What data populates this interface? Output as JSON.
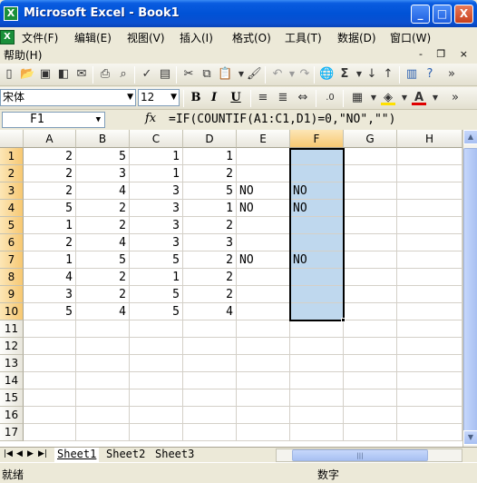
{
  "window": {
    "title": "Microsoft Excel - Book1",
    "minimize": "_",
    "maximize": "□",
    "close": "X"
  },
  "menu": {
    "items": [
      "文件(F)",
      "编辑(E)",
      "视图(V)",
      "插入(I)",
      "格式(O)",
      "工具(T)",
      "数据(D)",
      "窗口(W)",
      "帮助(H)"
    ],
    "mdi": "- ❐ ×"
  },
  "format": {
    "font_name": "宋体",
    "font_size": "12",
    "bold": "B",
    "italic": "I",
    "underline": "U"
  },
  "formula_bar": {
    "name_box": "F1",
    "fx": "fx",
    "formula": "=IF(COUNTIF(A1:C1,D1)=0,\"NO\",\"\")"
  },
  "grid": {
    "columns": [
      "A",
      "B",
      "C",
      "D",
      "E",
      "F",
      "G",
      "H"
    ],
    "rows": [
      "1",
      "2",
      "3",
      "4",
      "5",
      "6",
      "7",
      "8",
      "9",
      "10",
      "11",
      "12",
      "13",
      "14",
      "15",
      "16",
      "17"
    ],
    "data": [
      [
        "2",
        "5",
        "1",
        "1",
        "",
        ""
      ],
      [
        "2",
        "3",
        "1",
        "2",
        "",
        ""
      ],
      [
        "2",
        "4",
        "3",
        "5",
        "NO",
        "NO"
      ],
      [
        "5",
        "2",
        "3",
        "1",
        "NO",
        "NO"
      ],
      [
        "1",
        "2",
        "3",
        "2",
        "",
        ""
      ],
      [
        "2",
        "4",
        "3",
        "3",
        "",
        ""
      ],
      [
        "1",
        "5",
        "5",
        "2",
        "NO",
        "NO"
      ],
      [
        "4",
        "2",
        "1",
        "2",
        "",
        ""
      ],
      [
        "3",
        "2",
        "5",
        "2",
        "",
        ""
      ],
      [
        "5",
        "4",
        "5",
        "4",
        "",
        ""
      ]
    ]
  },
  "sheets": [
    "Sheet1",
    "Sheet2",
    "Sheet3"
  ],
  "status": {
    "left": "就绪",
    "mid": "数字"
  }
}
